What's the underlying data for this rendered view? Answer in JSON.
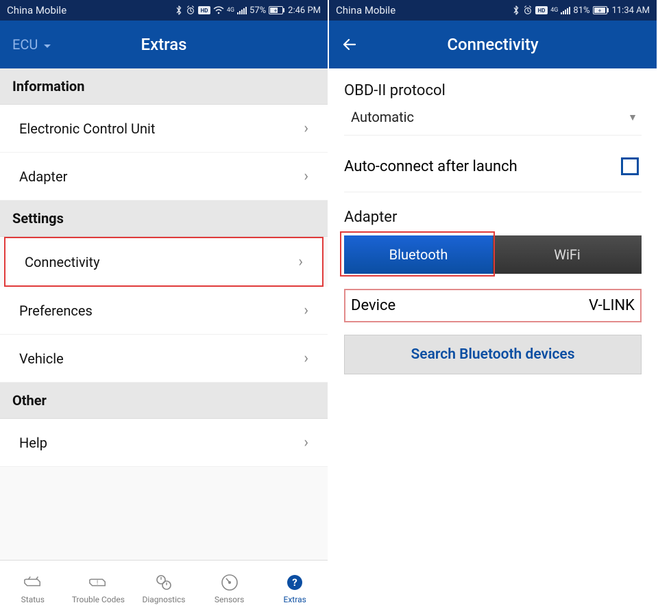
{
  "left": {
    "statusbar": {
      "carrier": "China Mobile",
      "battery": "57%",
      "time": "2:46 PM",
      "signal_tag": "4G"
    },
    "appbar": {
      "dropdown": "ECU",
      "title": "Extras"
    },
    "sections": {
      "information": {
        "header": "Information",
        "items": [
          "Electronic Control Unit",
          "Adapter"
        ]
      },
      "settings": {
        "header": "Settings",
        "items": [
          "Connectivity",
          "Preferences",
          "Vehicle"
        ],
        "highlighted": "Connectivity"
      },
      "other": {
        "header": "Other",
        "items": [
          "Help"
        ]
      }
    },
    "bottomnav": {
      "items": [
        "Status",
        "Trouble Codes",
        "Diagnostics",
        "Sensors",
        "Extras"
      ],
      "active": "Extras"
    }
  },
  "right": {
    "statusbar": {
      "carrier": "China Mobile",
      "battery": "81%",
      "time": "11:34 AM",
      "signal_tag": "4G"
    },
    "appbar": {
      "title": "Connectivity"
    },
    "protocol": {
      "label": "OBD-II protocol",
      "value": "Automatic"
    },
    "autoconnect": {
      "label": "Auto-connect after launch",
      "checked": false
    },
    "adapter": {
      "label": "Adapter",
      "options": [
        "Bluetooth",
        "WiFi"
      ],
      "selected": "Bluetooth"
    },
    "device": {
      "label": "Device",
      "value": "V-LINK"
    },
    "search_button": "Search Bluetooth devices"
  }
}
